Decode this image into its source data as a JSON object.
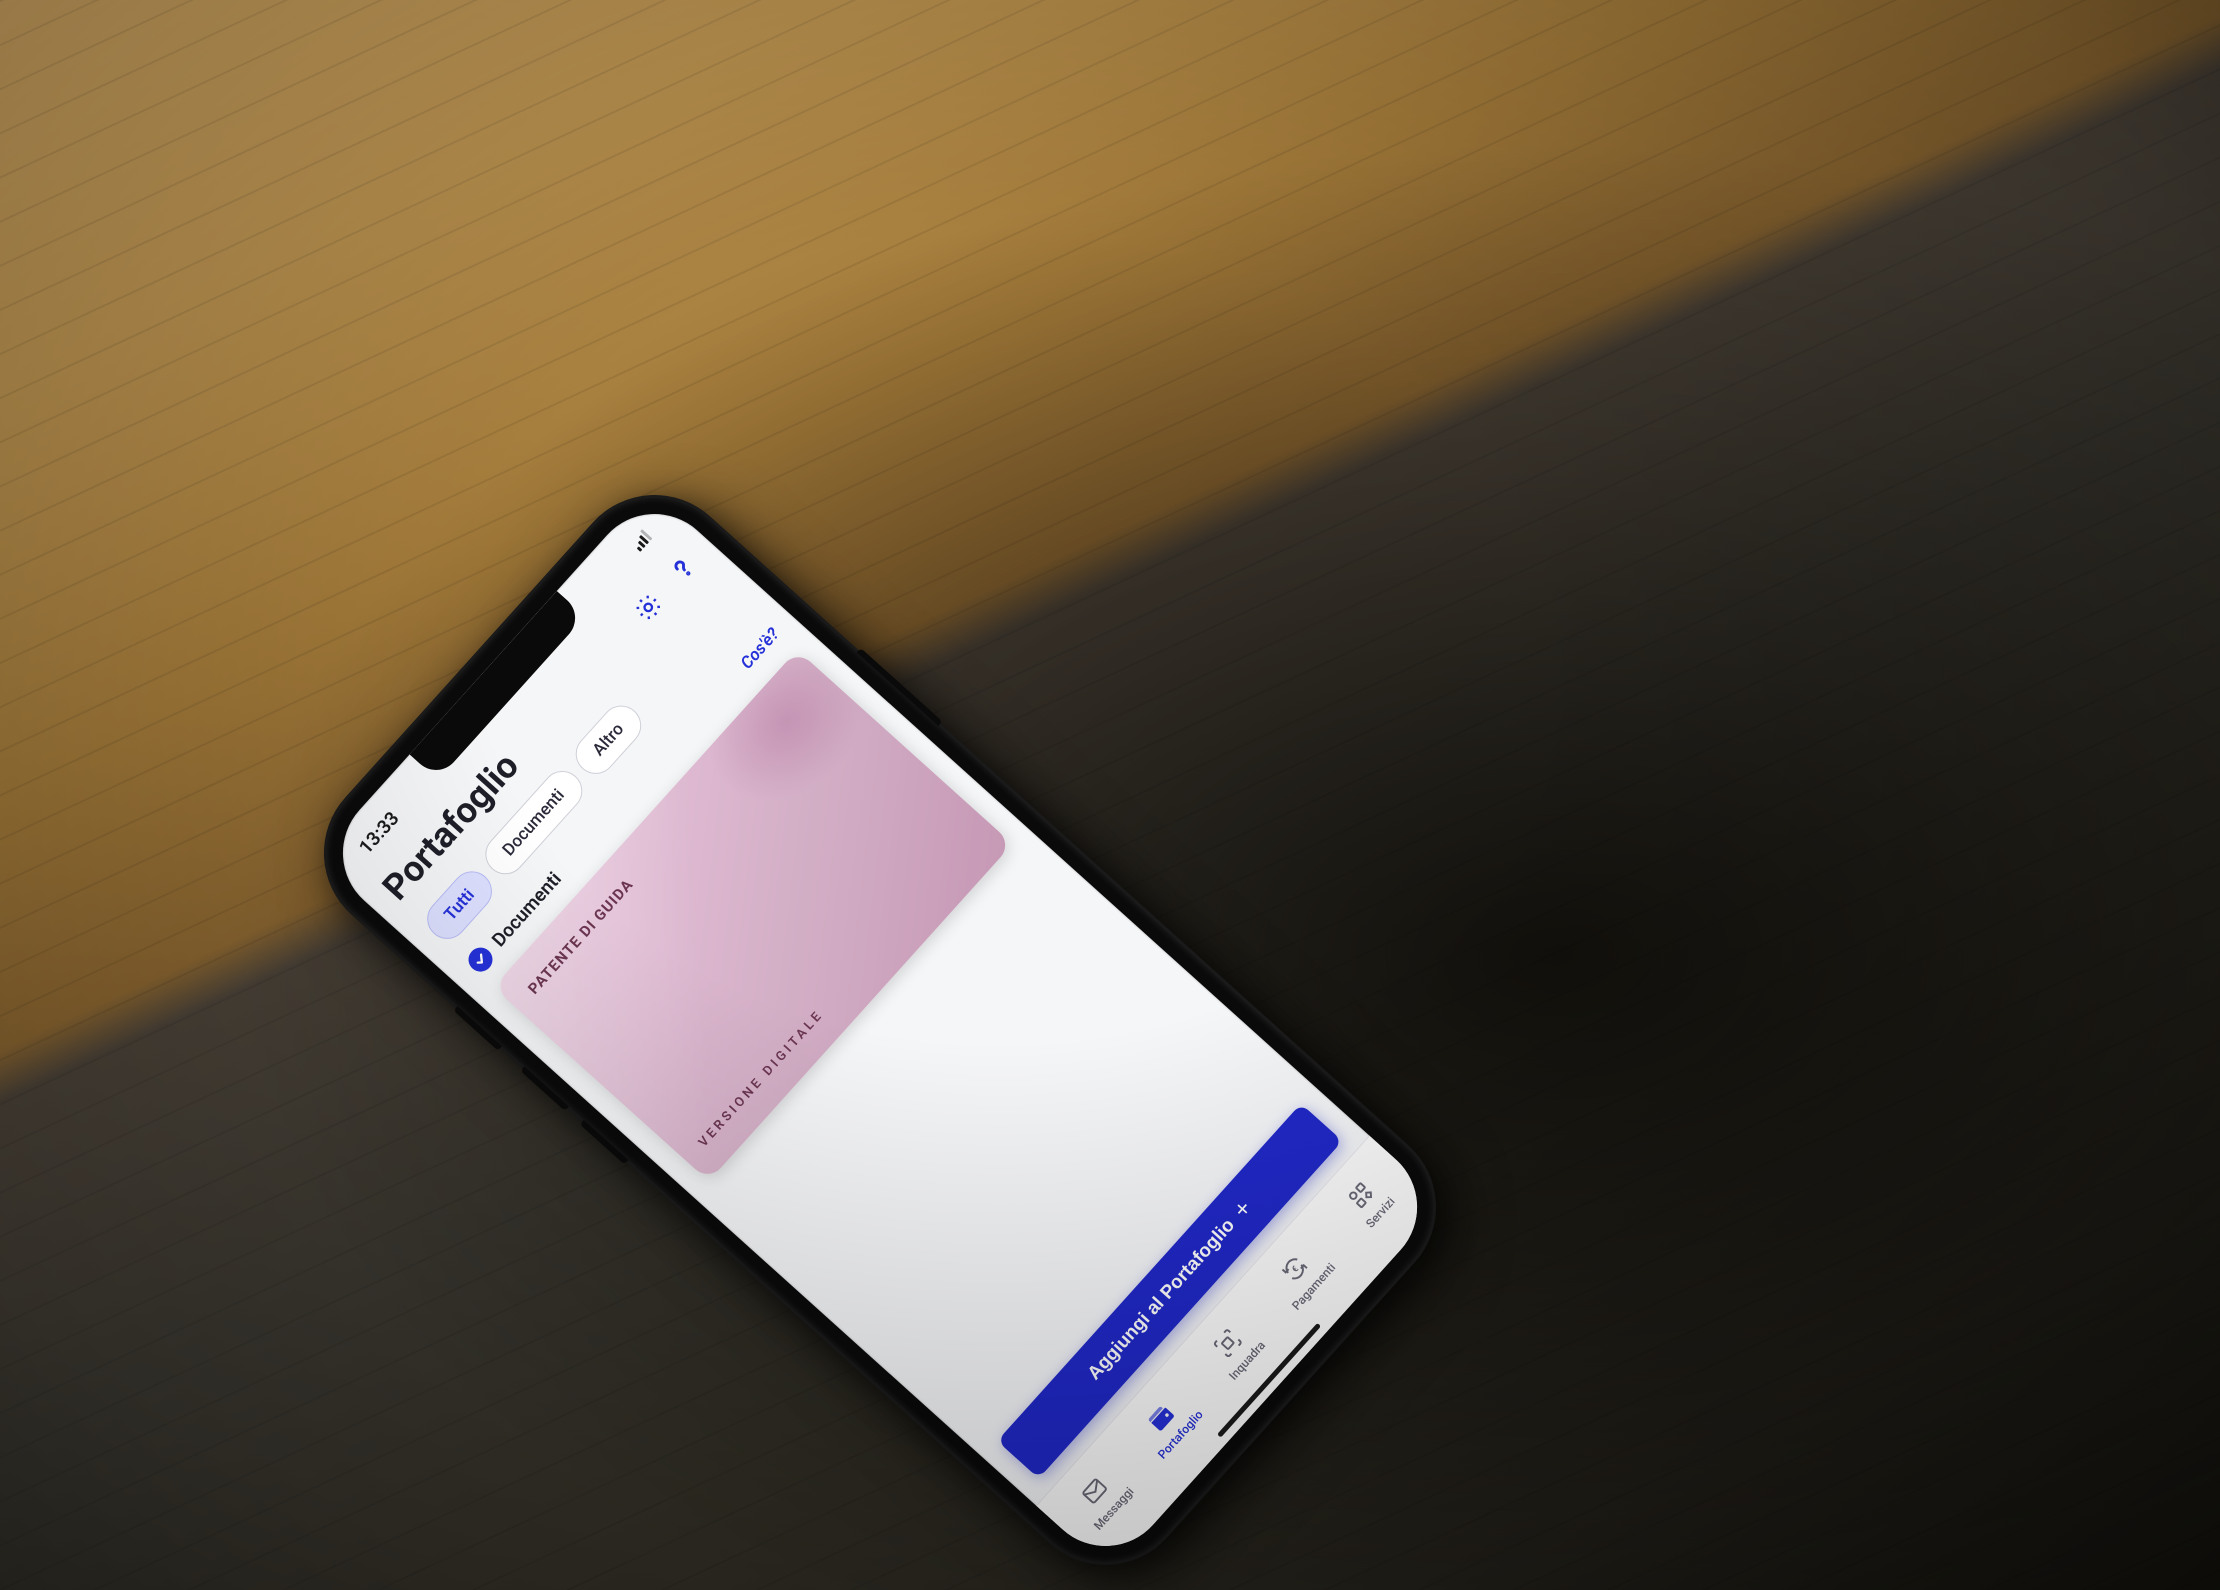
{
  "status": {
    "time": "13:33"
  },
  "header": {
    "title": "Portafoglio"
  },
  "filters": {
    "all": "Tutti",
    "documents": "Documenti",
    "other": "Altro"
  },
  "section": {
    "title": "Documenti",
    "info_link": "Cos'è?"
  },
  "license_card": {
    "title": "PATENTE DI GUIDA",
    "footer": "VERSIONE DIGITALE"
  },
  "cta": {
    "add": "Aggiungi al Portafoglio"
  },
  "nav": {
    "messages": "Messaggi",
    "wallet": "Portafoglio",
    "scan": "Inquadra",
    "payments": "Pagamenti",
    "services": "Servizi"
  },
  "colors": {
    "primary": "#2531d8",
    "button": "#2028c8",
    "card_bg": "#ddb8d0",
    "card_text": "#6b3550"
  }
}
